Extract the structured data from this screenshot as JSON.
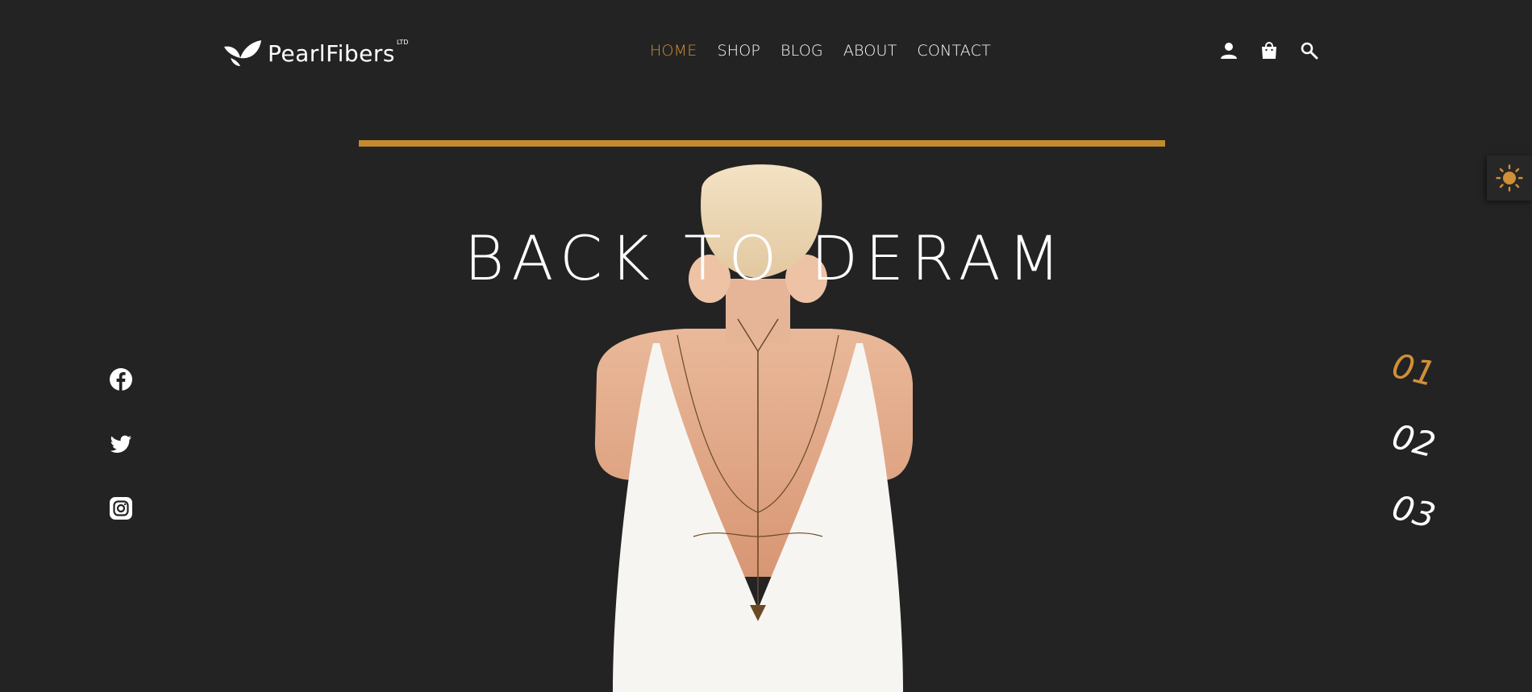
{
  "brand": {
    "name": "PearlFibers",
    "suffix": "LTD"
  },
  "nav": {
    "items": [
      {
        "label": "HOME",
        "active": true
      },
      {
        "label": "SHOP",
        "active": false
      },
      {
        "label": "BLOG",
        "active": false
      },
      {
        "label": "ABOUT",
        "active": false
      },
      {
        "label": "CONTACT",
        "active": false
      }
    ]
  },
  "header_icons": [
    "user-icon",
    "shopping-bag-icon",
    "search-icon"
  ],
  "hero": {
    "title": "BACK TO DERAM"
  },
  "socials": [
    "facebook-icon",
    "twitter-icon",
    "instagram-icon"
  ],
  "slides": {
    "items": [
      "01",
      "02",
      "03"
    ],
    "active_index": 0
  },
  "theme_toggle": {
    "icon": "sun-icon"
  },
  "colors": {
    "background": "#232323",
    "accent": "#c48a2f",
    "accent_text": "#d09038",
    "text": "#ffffff"
  }
}
